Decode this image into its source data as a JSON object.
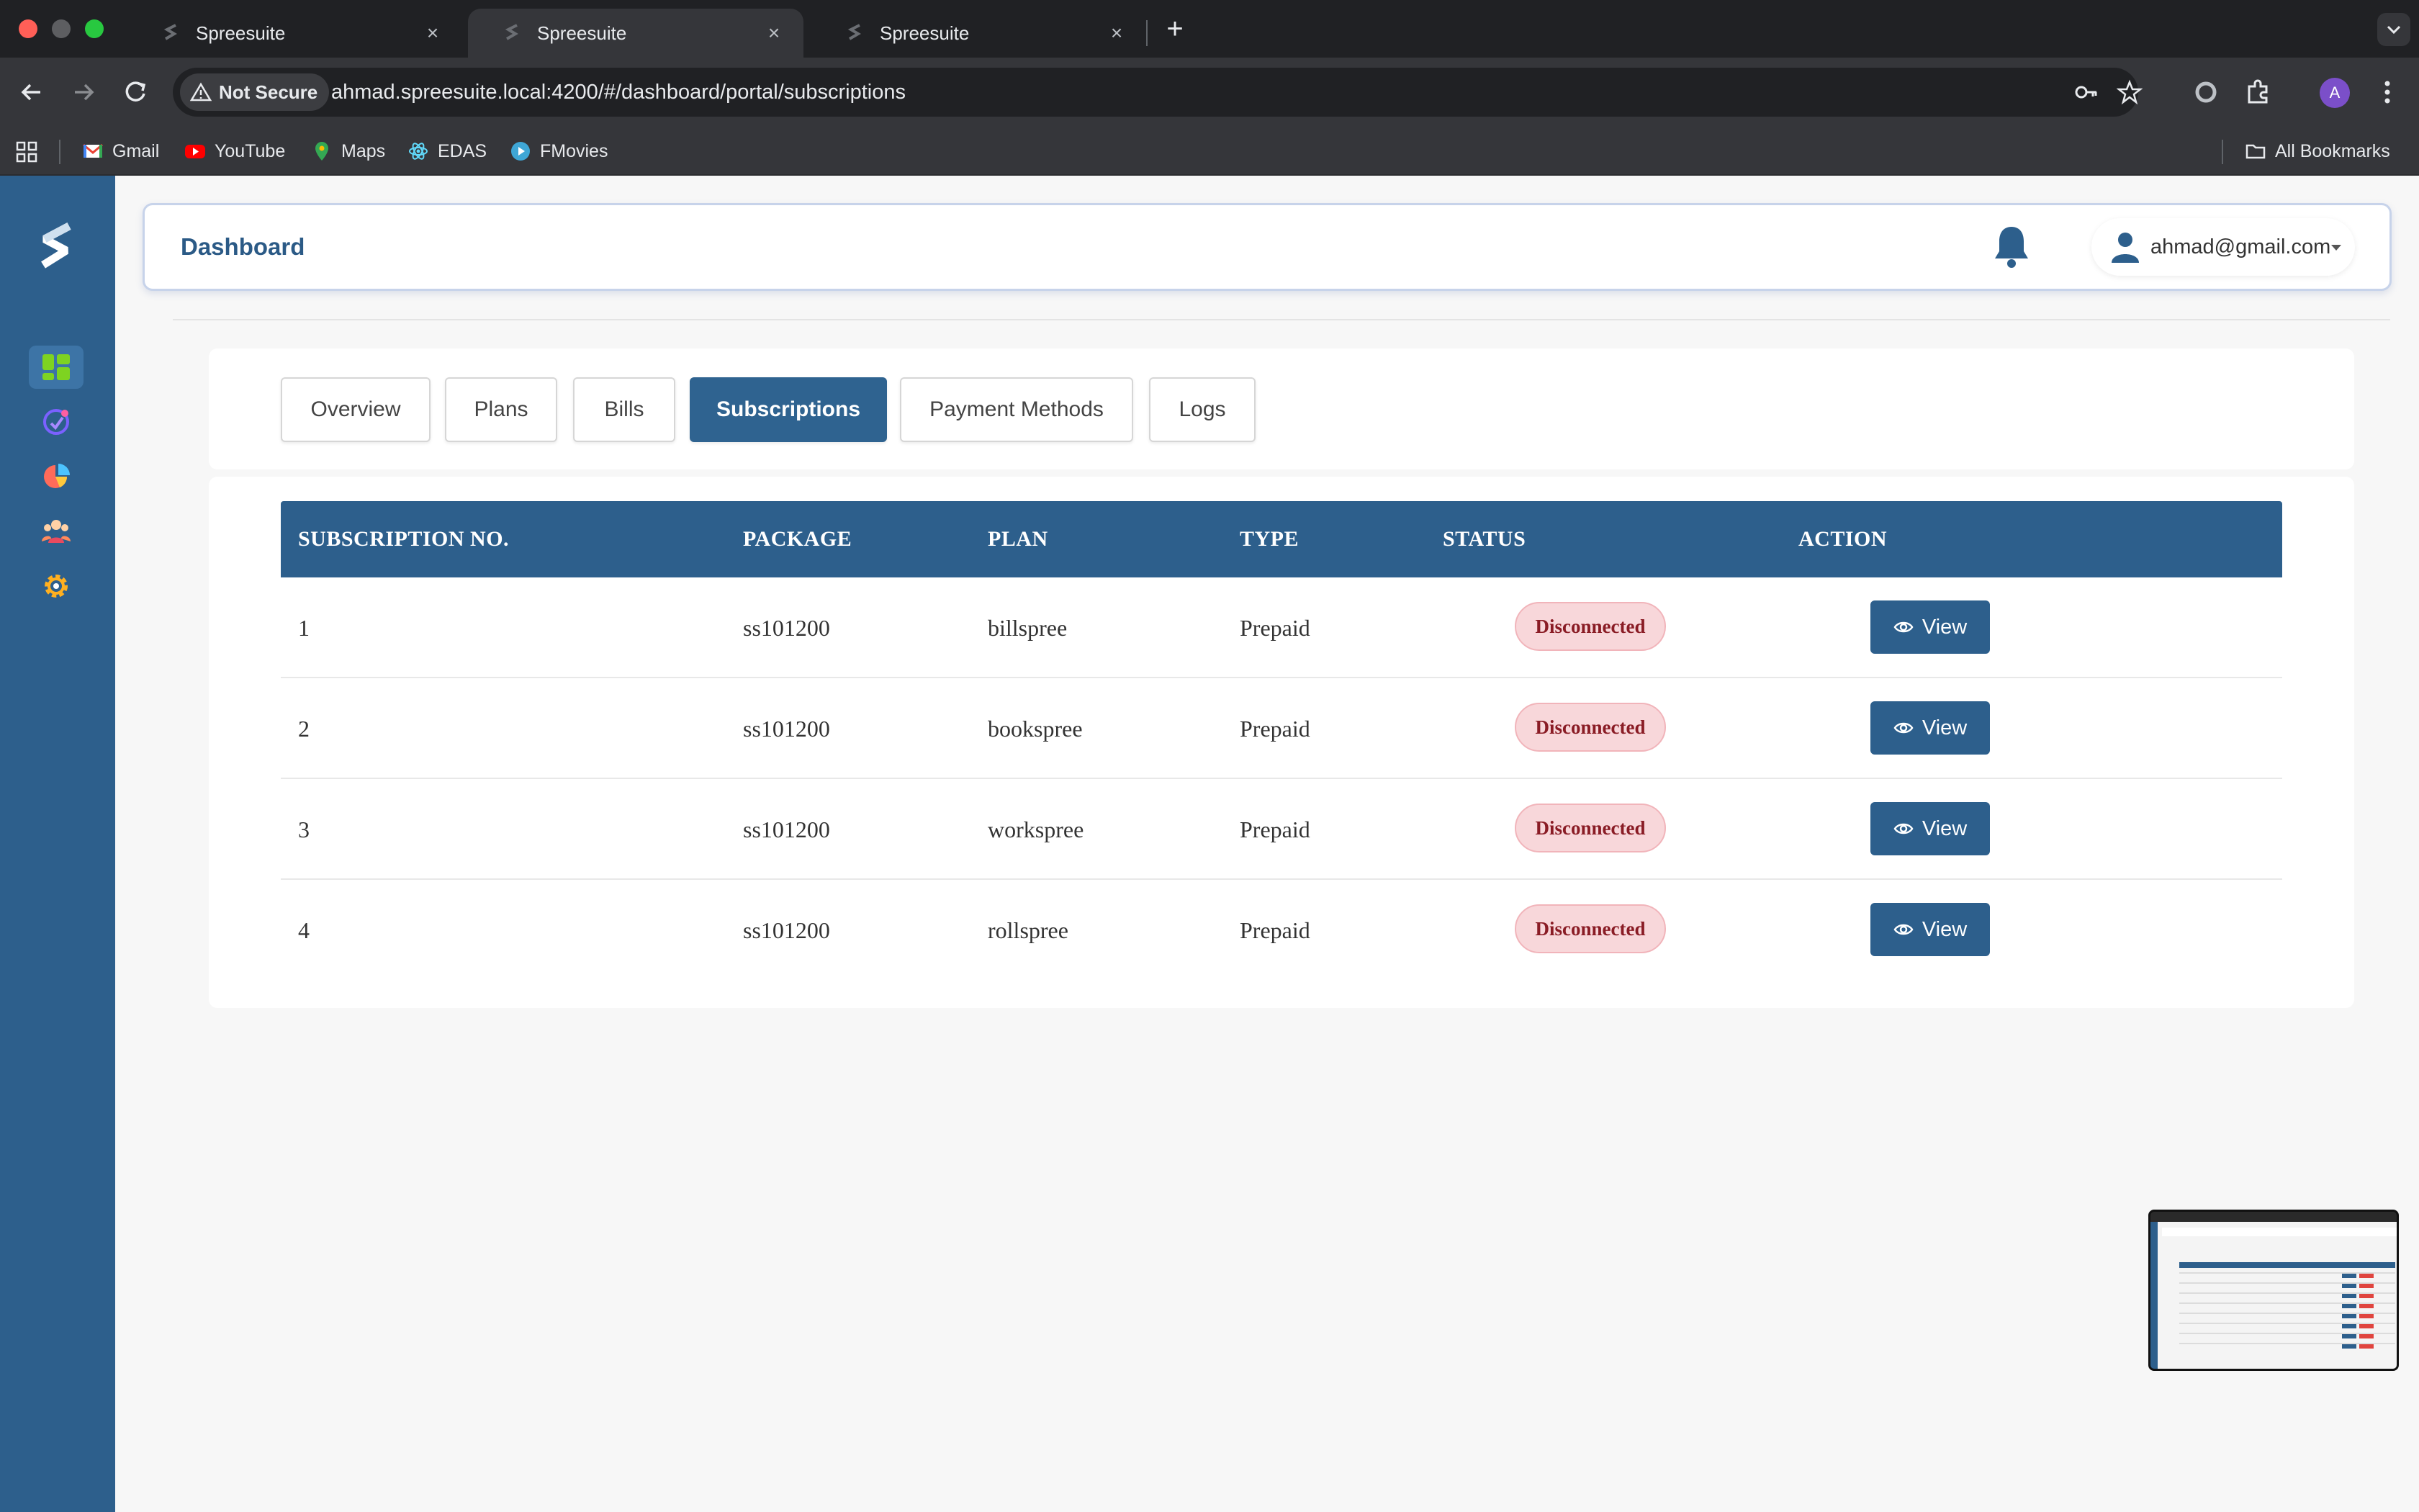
{
  "browser": {
    "tabs": [
      {
        "title": "Spreesuite",
        "close": "×"
      },
      {
        "title": "Spreesuite",
        "close": "×"
      },
      {
        "title": "Spreesuite",
        "close": "×"
      }
    ],
    "new_tab": "+",
    "security_chip": "Not Secure",
    "url": "ahmad.spreesuite.local:4200/#/dashboard/portal/subscriptions",
    "profile_initial": "A",
    "bookmarks": [
      {
        "label": "Gmail",
        "icon": "gmail-icon"
      },
      {
        "label": "YouTube",
        "icon": "youtube-icon"
      },
      {
        "label": "Maps",
        "icon": "maps-icon"
      },
      {
        "label": "EDAS",
        "icon": "react-icon"
      },
      {
        "label": "FMovies",
        "icon": "play-icon"
      }
    ],
    "all_bookmarks": "All Bookmarks"
  },
  "sidebar": {
    "items": [
      {
        "icon": "dashboard-icon",
        "active": true
      },
      {
        "icon": "security-icon"
      },
      {
        "icon": "pie-chart-icon"
      },
      {
        "icon": "team-icon"
      },
      {
        "icon": "gear-icon"
      }
    ]
  },
  "header": {
    "title": "Dashboard",
    "user_email": "ahmad@gmail.com"
  },
  "tabs": [
    {
      "label": "Overview"
    },
    {
      "label": "Plans"
    },
    {
      "label": "Bills"
    },
    {
      "label": "Subscriptions",
      "active": true
    },
    {
      "label": "Payment Methods"
    },
    {
      "label": "Logs"
    }
  ],
  "table": {
    "headers": [
      "SUBSCRIPTION NO.",
      "PACKAGE",
      "PLAN",
      "TYPE",
      "STATUS",
      "ACTION"
    ],
    "rows": [
      {
        "no": "1",
        "package": "ss101200",
        "plan": "billspree",
        "type": "Prepaid",
        "status": "Disconnected",
        "action": "View"
      },
      {
        "no": "2",
        "package": "ss101200",
        "plan": "bookspree",
        "type": "Prepaid",
        "status": "Disconnected",
        "action": "View"
      },
      {
        "no": "3",
        "package": "ss101200",
        "plan": "workspree",
        "type": "Prepaid",
        "status": "Disconnected",
        "action": "View"
      },
      {
        "no": "4",
        "package": "ss101200",
        "plan": "rollspree",
        "type": "Prepaid",
        "status": "Disconnected",
        "action": "View"
      }
    ]
  },
  "colors": {
    "brand": "#2d5f8c",
    "status_danger_bg": "#f8d7da",
    "status_danger_text": "#8a1c25"
  }
}
